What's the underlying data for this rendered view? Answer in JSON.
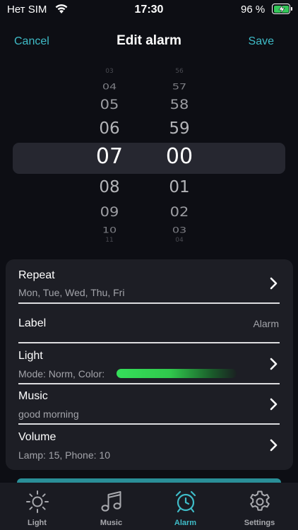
{
  "status_bar": {
    "carrier": "Нет SIM",
    "time": "17:30",
    "battery_percent": "96 %",
    "battery_charging": true
  },
  "nav": {
    "cancel_label": "Cancel",
    "title": "Edit alarm",
    "save_label": "Save"
  },
  "picker": {
    "hours": [
      "03",
      "04",
      "05",
      "06",
      "07",
      "08",
      "09",
      "10",
      "11"
    ],
    "minutes": [
      "56",
      "57",
      "58",
      "59",
      "00",
      "01",
      "02",
      "03",
      "04"
    ],
    "selected_hour": "07",
    "selected_minute": "00"
  },
  "settings": {
    "repeat": {
      "title": "Repeat",
      "subtitle": "Mon, Tue, Wed, Thu, Fri"
    },
    "label": {
      "title": "Label",
      "value": "Alarm"
    },
    "light": {
      "title": "Light",
      "subtitle": "Mode: Norm, Color:",
      "color": "#35e05a"
    },
    "music": {
      "title": "Music",
      "subtitle": "good morning"
    },
    "volume": {
      "title": "Volume",
      "subtitle": "Lamp: 15, Phone: 10"
    }
  },
  "tabs": [
    {
      "label": "Light",
      "icon": "sun-icon",
      "active": false
    },
    {
      "label": "Music",
      "icon": "music-note-icon",
      "active": false
    },
    {
      "label": "Alarm",
      "icon": "alarm-clock-icon",
      "active": true
    },
    {
      "label": "Settings",
      "icon": "gear-icon",
      "active": false
    }
  ],
  "colors": {
    "accent": "#3fbcc8",
    "background": "#0d0e14",
    "card": "#1d1e25"
  }
}
